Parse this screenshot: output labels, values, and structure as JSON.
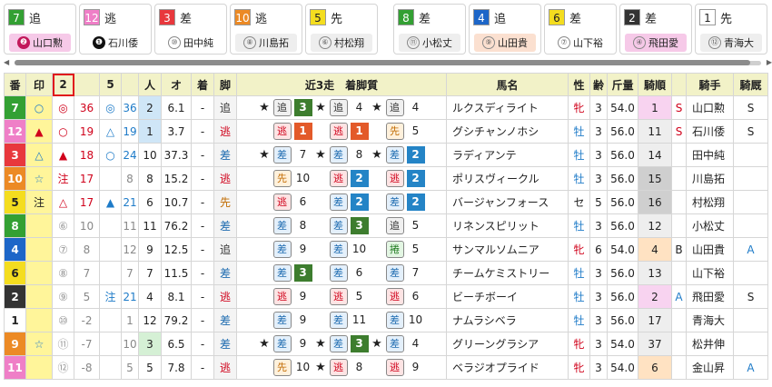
{
  "frames": {
    "1": "#ffffff",
    "2": "#333333",
    "3": "#e8383d",
    "4": "#1d66c8",
    "5": "#f4dd1f",
    "6": "#33a033",
    "7": "#ec8a25",
    "8": "#ef7fc7"
  },
  "cards": [
    {
      "num": "7",
      "frame": "6",
      "leg": "追",
      "mark": "❷",
      "mark_style": "solidpink",
      "jockey": "山口勲",
      "bg": "#f6c9e8"
    },
    {
      "num": "12",
      "frame": "8",
      "leg": "逃",
      "mark": "❶",
      "mark_style": "solid",
      "jockey": "石川倭",
      "bg": "#ffffff"
    },
    {
      "num": "3",
      "frame": "3",
      "leg": "差",
      "mark": "⑩",
      "mark_style": "circle",
      "jockey": "田中純",
      "bg": "#ffffff"
    },
    {
      "num": "10",
      "frame": "7",
      "leg": "逃",
      "mark": "⑧",
      "mark_style": "circle",
      "jockey": "川島拓",
      "bg": "#eeeeee"
    },
    {
      "num": "5",
      "frame": "5",
      "leg": "先",
      "mark": "⑥",
      "mark_style": "circle",
      "jockey": "村松翔",
      "bg": "#eeeeee"
    },
    {
      "num": "8",
      "frame": "6",
      "leg": "差",
      "mark": "⑪",
      "mark_style": "circle",
      "jockey": "小松丈",
      "bg": "#eeeeee"
    },
    {
      "num": "4",
      "frame": "4",
      "leg": "追",
      "mark": "⑨",
      "mark_style": "circle",
      "jockey": "山田貴",
      "bg": "#fbe0d0"
    },
    {
      "num": "6",
      "frame": "5",
      "leg": "差",
      "mark": "⑦",
      "mark_style": "circle",
      "jockey": "山下裕",
      "bg": "#ffffff"
    },
    {
      "num": "2",
      "frame": "2",
      "leg": "差",
      "mark": "④",
      "mark_style": "circle",
      "jockey": "飛田愛",
      "bg": "#f6c9e8"
    },
    {
      "num": "1",
      "frame": "1",
      "leg": "先",
      "mark": "⑫",
      "mark_style": "circle",
      "jockey": "青海大",
      "bg": "#eeeeee"
    }
  ],
  "headers": [
    "番",
    "印",
    "2",
    "",
    "5",
    "",
    "人",
    "オ",
    "着",
    "脚",
    "近3走　着脚質",
    "馬名",
    "性",
    "齢",
    "斤量",
    "騎順",
    "",
    "騎手",
    "騎厩"
  ],
  "rows": [
    {
      "num": "7",
      "frame": "6",
      "mark": "○",
      "mark_bg": "#fff59a",
      "m2": "◎",
      "v2": "36",
      "m5": "◎",
      "v5": "36",
      "pop": "2",
      "pop_bg": "#cfe6f7",
      "odds": "6.1",
      "chaku": "-",
      "leg": "追",
      "leg_cls": "oikomi",
      "recent": [
        [
          "★",
          "追",
          "3",
          "mk"
        ],
        [
          "★",
          "追",
          "4",
          ""
        ],
        [
          "★",
          "追",
          "4",
          ""
        ]
      ],
      "name": "ルクスディライト",
      "sex": "牝",
      "age": "3",
      "kin": "54.0",
      "kijun": "1",
      "kijun_cls": "hr1",
      "kflag": "S",
      "kflag_cls": "red",
      "jockey": "山口勲",
      "kyusya": "S",
      "kyusya_cls": ""
    },
    {
      "num": "12",
      "frame": "8",
      "mark": "▲",
      "mark_bg": "#fff59a",
      "m2": "○",
      "v2": "19",
      "m5": "△",
      "v5": "19",
      "pop": "1",
      "pop_bg": "#cfe6f7",
      "odds": "3.7",
      "chaku": "-",
      "leg": "逃",
      "leg_cls": "nige",
      "recent": [
        [
          "",
          "逃",
          "1",
          "r"
        ],
        [
          "",
          "逃",
          "1",
          "r"
        ],
        [
          "",
          "先",
          "5",
          ""
        ]
      ],
      "name": "グシチャンノホシ",
      "sex": "牡",
      "age": "3",
      "kin": "56.0",
      "kijun": "11",
      "kijun_cls": "hr2",
      "kflag": "S",
      "kflag_cls": "red",
      "jockey": "石川倭",
      "kyusya": "S",
      "kyusya_cls": ""
    },
    {
      "num": "3",
      "frame": "3",
      "mark": "△",
      "mark_bg": "#fff59a",
      "m2": "▲",
      "v2": "18",
      "m5": "○",
      "v5": "24",
      "pop": "10",
      "pop_bg": "#ffffff",
      "odds": "37.3",
      "chaku": "-",
      "leg": "差",
      "leg_cls": "sashi",
      "recent": [
        [
          "★",
          "差",
          "7",
          ""
        ],
        [
          "★",
          "差",
          "8",
          ""
        ],
        [
          "★",
          "差",
          "2",
          "b"
        ]
      ],
      "name": "ラディアンテ",
      "sex": "牡",
      "age": "3",
      "kin": "56.0",
      "kijun": "14",
      "kijun_cls": "hr2",
      "kflag": "",
      "kflag_cls": "",
      "jockey": "田中純",
      "kyusya": "",
      "kyusya_cls": ""
    },
    {
      "num": "10",
      "frame": "7",
      "mark": "☆",
      "mark_bg": "#fff59a",
      "m2": "注",
      "v2": "17",
      "m5": "",
      "v5": "8",
      "pop": "8",
      "pop_bg": "#ffffff",
      "odds": "15.2",
      "chaku": "-",
      "leg": "逃",
      "leg_cls": "nige",
      "recent": [
        [
          "",
          "先",
          "10",
          ""
        ],
        [
          "",
          "逃",
          "2",
          "b"
        ],
        [
          "",
          "逃",
          "2",
          "b"
        ]
      ],
      "name": "ポリスヴィークル",
      "sex": "牡",
      "age": "3",
      "kin": "56.0",
      "kijun": "15",
      "kijun_cls": "hrhi",
      "kflag": "",
      "kflag_cls": "",
      "jockey": "川島拓",
      "kyusya": "",
      "kyusya_cls": ""
    },
    {
      "num": "5",
      "frame": "5",
      "mark": "注",
      "mark_bg": "#fff59a",
      "m2": "△",
      "v2": "17",
      "m5": "▲",
      "v5": "21",
      "pop": "6",
      "pop_bg": "#ffffff",
      "odds": "10.7",
      "chaku": "-",
      "leg": "先",
      "leg_cls": "sen",
      "recent": [
        [
          "",
          "逃",
          "6",
          ""
        ],
        [
          "",
          "差",
          "2",
          "b"
        ],
        [
          "",
          "差",
          "2",
          "b"
        ]
      ],
      "name": "バージャンフォース",
      "sex": "セ",
      "age": "5",
      "kin": "56.0",
      "kijun": "16",
      "kijun_cls": "hrhi",
      "kflag": "",
      "kflag_cls": "",
      "jockey": "村松翔",
      "kyusya": "",
      "kyusya_cls": ""
    },
    {
      "num": "8",
      "frame": "6",
      "mark": "",
      "mark_bg": "#fff59a",
      "m2": "⑥",
      "v2": "10",
      "m5": "",
      "v5": "11",
      "pop": "11",
      "pop_bg": "#ffffff",
      "odds": "76.2",
      "chaku": "-",
      "leg": "差",
      "leg_cls": "sashi",
      "recent": [
        [
          "",
          "差",
          "8",
          ""
        ],
        [
          "",
          "差",
          "3",
          "g"
        ],
        [
          "",
          "追",
          "5",
          ""
        ]
      ],
      "name": "リネンスピリット",
      "sex": "牡",
      "age": "3",
      "kin": "56.0",
      "kijun": "12",
      "kijun_cls": "hr2",
      "kflag": "",
      "kflag_cls": "",
      "jockey": "小松丈",
      "kyusya": "",
      "kyusya_cls": ""
    },
    {
      "num": "4",
      "frame": "4",
      "mark": "",
      "mark_bg": "#fff59a",
      "m2": "⑦",
      "v2": "8",
      "m5": "",
      "v5": "12",
      "pop": "9",
      "pop_bg": "#ffffff",
      "odds": "12.5",
      "chaku": "-",
      "leg": "追",
      "leg_cls": "oikomi",
      "recent": [
        [
          "",
          "差",
          "9",
          ""
        ],
        [
          "",
          "差",
          "10",
          ""
        ],
        [
          "",
          "捲",
          "5",
          "mk2"
        ]
      ],
      "name": "サンマルソムニア",
      "sex": "牝",
      "age": "6",
      "kin": "54.0",
      "kijun": "4",
      "kijun_cls": "hr3",
      "kflag": "B",
      "kflag_cls": "",
      "jockey": "山田貴",
      "kyusya": "A",
      "kyusya_cls": "blue"
    },
    {
      "num": "6",
      "frame": "5",
      "mark": "",
      "mark_bg": "#fff59a",
      "m2": "⑧",
      "v2": "7",
      "m5": "",
      "v5": "7",
      "pop": "7",
      "pop_bg": "#ffffff",
      "odds": "11.5",
      "chaku": "-",
      "leg": "差",
      "leg_cls": "sashi",
      "recent": [
        [
          "",
          "差",
          "3",
          "g"
        ],
        [
          "",
          "差",
          "6",
          ""
        ],
        [
          "",
          "差",
          "7",
          ""
        ]
      ],
      "name": "チームケミストリー",
      "sex": "牡",
      "age": "3",
      "kin": "56.0",
      "kijun": "13",
      "kijun_cls": "hr2",
      "kflag": "",
      "kflag_cls": "",
      "jockey": "山下裕",
      "kyusya": "",
      "kyusya_cls": ""
    },
    {
      "num": "2",
      "frame": "2",
      "mark": "",
      "mark_bg": "#fff59a",
      "m2": "⑨",
      "v2": "5",
      "m5": "注",
      "v5": "21",
      "pop": "4",
      "pop_bg": "#ffffff",
      "odds": "8.1",
      "chaku": "-",
      "leg": "逃",
      "leg_cls": "nige",
      "recent": [
        [
          "",
          "逃",
          "9",
          ""
        ],
        [
          "",
          "逃",
          "5",
          ""
        ],
        [
          "",
          "逃",
          "6",
          ""
        ]
      ],
      "name": "ビーチボーイ",
      "sex": "牡",
      "age": "3",
      "kin": "56.0",
      "kijun": "2",
      "kijun_cls": "hr1",
      "kflag": "A",
      "kflag_cls": "blue",
      "jockey": "飛田愛",
      "kyusya": "S",
      "kyusya_cls": ""
    },
    {
      "num": "1",
      "frame": "1",
      "mark": "",
      "mark_bg": "#fff59a",
      "m2": "⑩",
      "v2": "-2",
      "m5": "",
      "v5": "1",
      "pop": "12",
      "pop_bg": "#ffffff",
      "odds": "79.2",
      "chaku": "-",
      "leg": "差",
      "leg_cls": "sashi",
      "recent": [
        [
          "",
          "差",
          "9",
          ""
        ],
        [
          "",
          "差",
          "11",
          ""
        ],
        [
          "",
          "差",
          "10",
          ""
        ]
      ],
      "name": "ナムラシベラ",
      "sex": "牡",
      "age": "3",
      "kin": "56.0",
      "kijun": "17",
      "kijun_cls": "hr2",
      "kflag": "",
      "kflag_cls": "",
      "jockey": "青海大",
      "kyusya": "",
      "kyusya_cls": ""
    },
    {
      "num": "9",
      "frame": "7",
      "mark": "☆",
      "mark_bg": "#fff59a",
      "m2": "⑪",
      "v2": "-7",
      "m5": "",
      "v5": "10",
      "pop": "3",
      "pop_bg": "#d5f0d5",
      "odds": "6.5",
      "chaku": "-",
      "leg": "差",
      "leg_cls": "sashi",
      "recent": [
        [
          "★",
          "差",
          "9",
          ""
        ],
        [
          "★",
          "差",
          "3",
          "g"
        ],
        [
          "★",
          "差",
          "4",
          ""
        ]
      ],
      "name": "グリーングラシア",
      "sex": "牝",
      "age": "3",
      "kin": "54.0",
      "kijun": "37",
      "kijun_cls": "hr2",
      "kflag": "",
      "kflag_cls": "",
      "jockey": "松井伸",
      "kyusya": "",
      "kyusya_cls": ""
    },
    {
      "num": "11",
      "frame": "8",
      "mark": "",
      "mark_bg": "#fff59a",
      "m2": "⑫",
      "v2": "-8",
      "m5": "",
      "v5": "5",
      "pop": "5",
      "pop_bg": "#ffffff",
      "odds": "7.8",
      "chaku": "-",
      "leg": "逃",
      "leg_cls": "nige",
      "recent": [
        [
          "",
          "先",
          "10",
          ""
        ],
        [
          "★",
          "逃",
          "8",
          ""
        ],
        [
          "",
          "逃",
          "9",
          ""
        ]
      ],
      "name": "ベラジオプライド",
      "sex": "牝",
      "age": "3",
      "kin": "54.0",
      "kijun": "6",
      "kijun_cls": "hr3",
      "kflag": "",
      "kflag_cls": "",
      "jockey": "金山昇",
      "kyusya": "A",
      "kyusya_cls": "blue"
    }
  ]
}
